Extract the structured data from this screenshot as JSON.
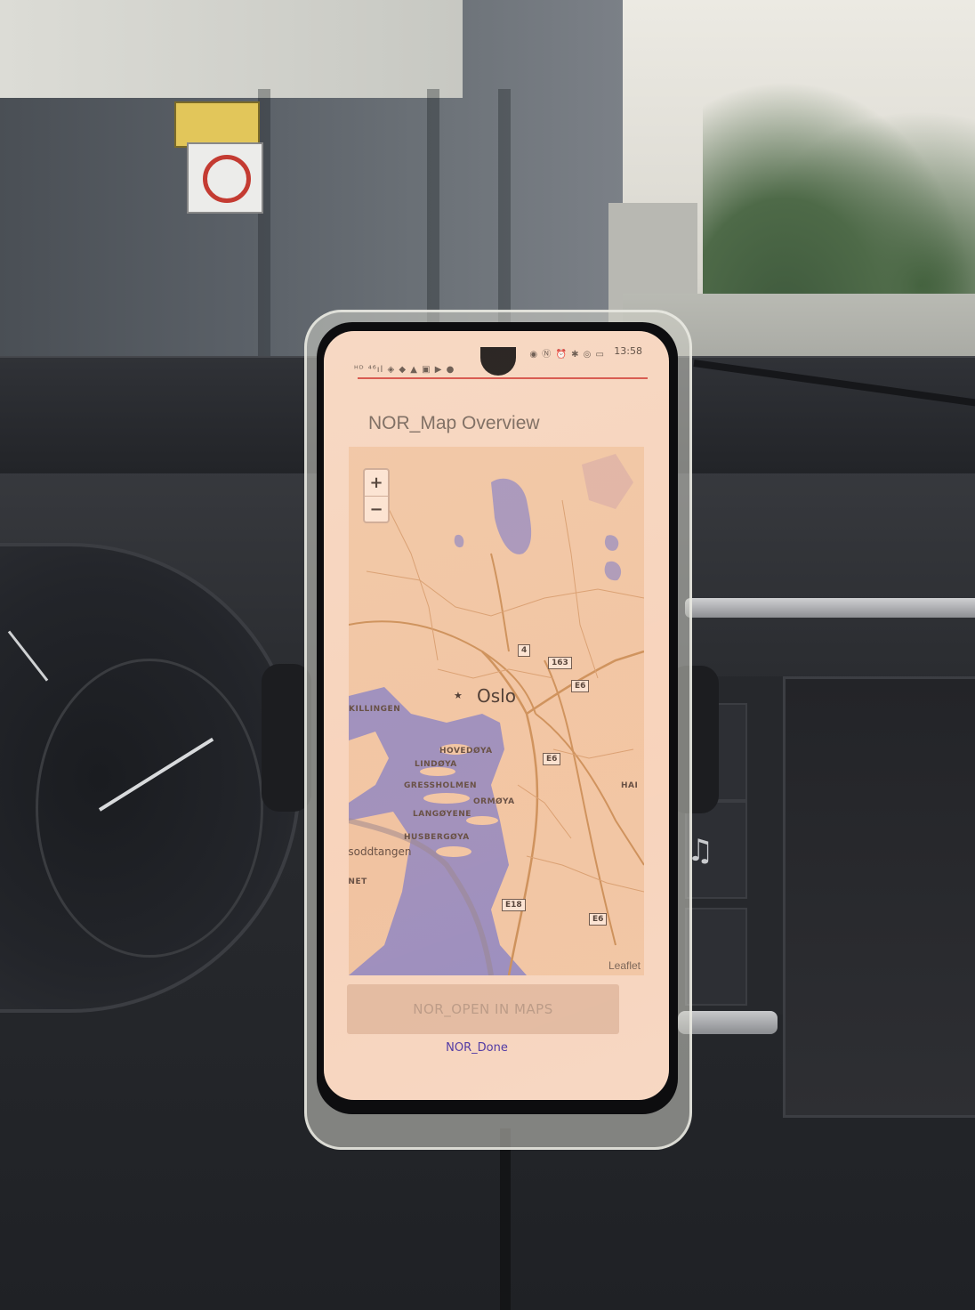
{
  "status_bar": {
    "left_icons": "ᴴᴰ ⁴⁶ıl ◈ ◆ ▲ ▣ ▶ ●",
    "right_icons": "◉ Ⓝ ⏰ ✱ ◎ ▭",
    "time": "13:58"
  },
  "app": {
    "title": "NOR_Map Overview"
  },
  "map": {
    "zoom_in": "+",
    "zoom_out": "−",
    "city": "Oslo",
    "places": {
      "killingen": "KILLINGEN",
      "hovedoya": "HOVEDØYA",
      "lindoya": "LINDØYA",
      "gressholmen": "GRESSHOLMEN",
      "ormoya": "ORMØYA",
      "langoyene": "LANGØYENE",
      "husbergoya": "HUSBERGØYA",
      "nesoddtangen": "esoddtangen",
      "rnet": "RNET",
      "hal": "HAI"
    },
    "roads": {
      "r4": "4",
      "r163": "163",
      "e6_a": "E6",
      "e6_b": "E6",
      "e6_c": "E6",
      "e18": "E18"
    },
    "attribution": "Leaflet"
  },
  "actions": {
    "open_in_maps": "NOR_OPEN IN MAPS",
    "done": "NOR_Done"
  },
  "colors": {
    "accent_line": "#d24a43",
    "done_link": "#3d2aa5",
    "water": "#8f88c4",
    "land": "#f0c7a6"
  },
  "scene": {
    "music_icon": "music-note-icon"
  }
}
